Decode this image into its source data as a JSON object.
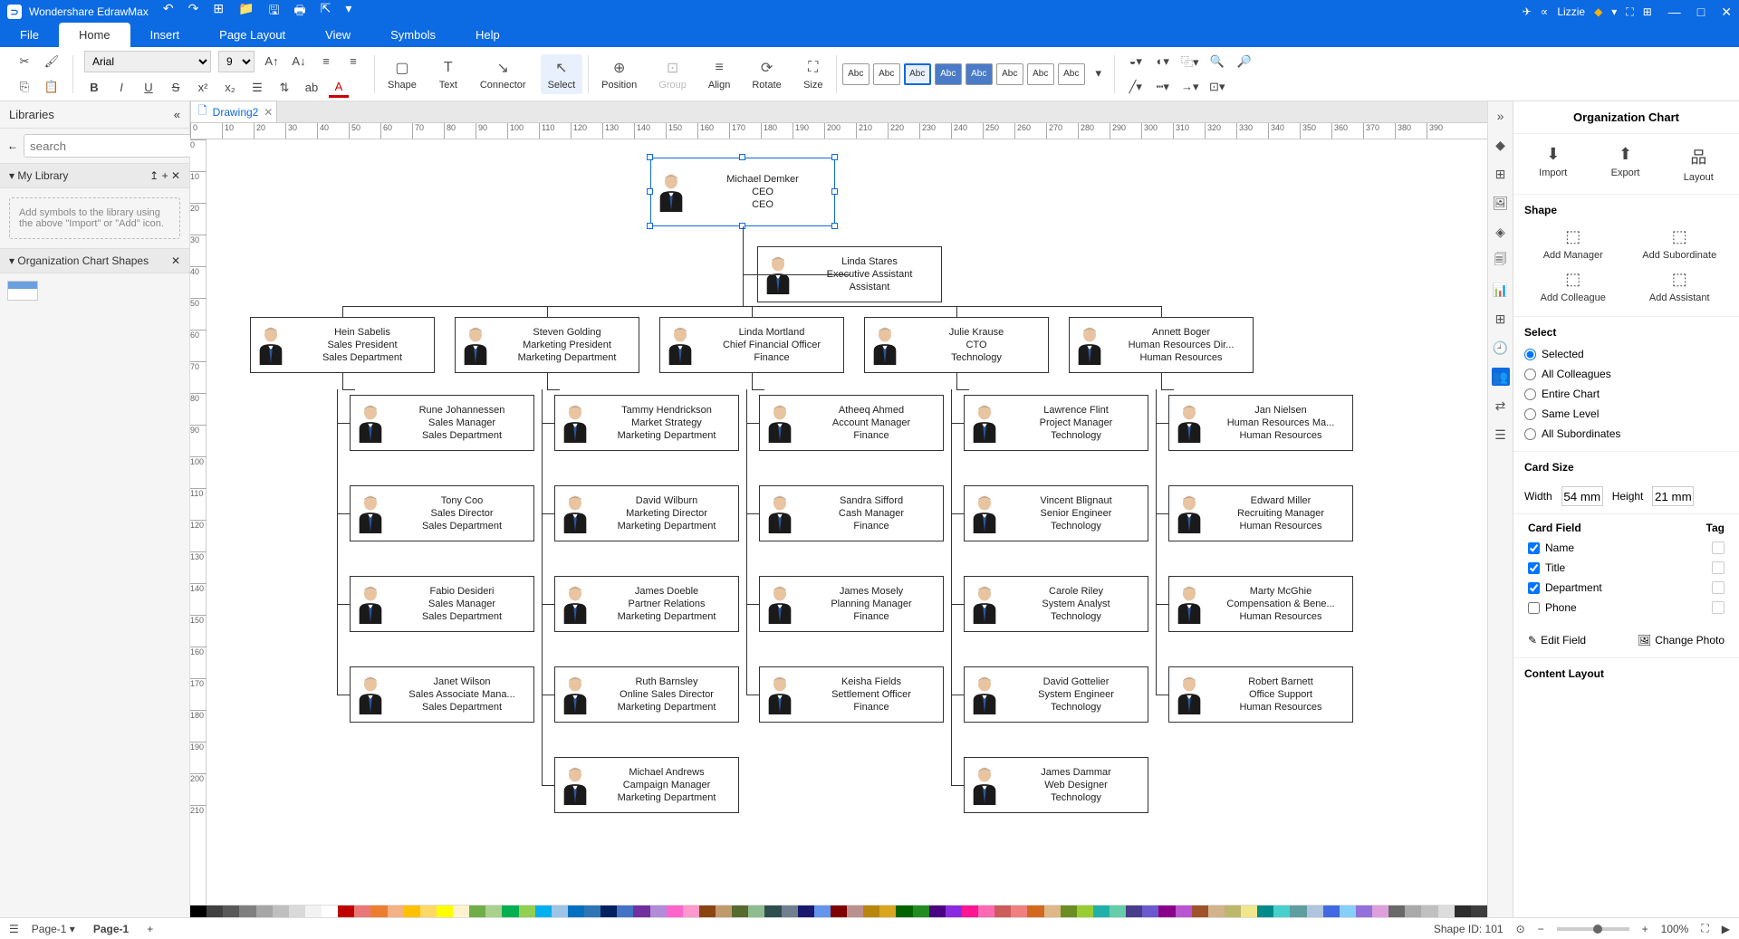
{
  "app": {
    "title": "Wondershare EdrawMax",
    "user": "Lizzie"
  },
  "menu": {
    "file": "File",
    "home": "Home",
    "insert": "Insert",
    "pagelayout": "Page Layout",
    "view": "View",
    "symbols": "Symbols",
    "help": "Help"
  },
  "ribbon": {
    "font": "Arial",
    "size": "9",
    "shape": "Shape",
    "text": "Text",
    "connector": "Connector",
    "select": "Select",
    "position": "Position",
    "group": "Group",
    "align": "Align",
    "rotate": "Rotate",
    "sizeLbl": "Size",
    "style": "Abc"
  },
  "left": {
    "libraries": "Libraries",
    "search_ph": "search",
    "mylib": "My Library",
    "addhint": "Add symbols to the library using the above \"Import\" or \"Add\" icon.",
    "orgshapes": "Organization Chart Shapes"
  },
  "doc": {
    "tab": "Drawing2"
  },
  "right": {
    "title": "Organization Chart",
    "import": "Import",
    "export": "Export",
    "layout": "Layout",
    "shape": "Shape",
    "addmgr": "Add Manager",
    "addsub": "Add Subordinate",
    "addcol": "Add Colleague",
    "addass": "Add Assistant",
    "select": "Select",
    "r_selected": "Selected",
    "r_allcol": "All Colleagues",
    "r_entire": "Entire Chart",
    "r_same": "Same Level",
    "r_allsub": "All Subordinates",
    "cardsize": "Card Size",
    "width": "Width",
    "wval": "54 mm",
    "height": "Height",
    "hval": "21 mm",
    "cardfield": "Card Field",
    "tag": "Tag",
    "f_name": "Name",
    "f_title": "Title",
    "f_dept": "Department",
    "f_phone": "Phone",
    "editfield": "Edit Field",
    "changephoto": "Change Photo",
    "contentlayout": "Content Layout"
  },
  "status": {
    "page": "Page-1",
    "pagetab": "Page-1",
    "shapeid": "Shape ID: 101",
    "zoom": "100%"
  },
  "chart": {
    "ceo": {
      "name": "Michael Demker",
      "title": "CEO",
      "dept": "CEO"
    },
    "assistant": {
      "name": "Linda Stares",
      "title": "Executive Assistant",
      "dept": "Assistant"
    },
    "managers": [
      {
        "name": "Hein Sabelis",
        "title": "Sales President",
        "dept": "Sales Department"
      },
      {
        "name": "Steven Golding",
        "title": "Marketing President",
        "dept": "Marketing Department"
      },
      {
        "name": "Linda Mortland",
        "title": "Chief Financial Officer",
        "dept": "Finance"
      },
      {
        "name": "Julie Krause",
        "title": "CTO",
        "dept": "Technology"
      },
      {
        "name": "Annett Boger",
        "title": "Human Resources Dir...",
        "dept": "Human Resources"
      }
    ],
    "subs": [
      [
        {
          "name": "Rune Johannessen",
          "title": "Sales Manager",
          "dept": "Sales Department"
        },
        {
          "name": "Tony Coo",
          "title": "Sales Director",
          "dept": "Sales Department"
        },
        {
          "name": "Fabio Desideri",
          "title": "Sales Manager",
          "dept": "Sales Department"
        },
        {
          "name": "Janet Wilson",
          "title": "Sales Associate Mana...",
          "dept": "Sales Department"
        }
      ],
      [
        {
          "name": "Tammy Hendrickson",
          "title": "Market Strategy",
          "dept": "Marketing Department"
        },
        {
          "name": "David Wilburn",
          "title": "Marketing Director",
          "dept": "Marketing Department"
        },
        {
          "name": "James Doeble",
          "title": "Partner Relations",
          "dept": "Marketing Department"
        },
        {
          "name": "Ruth Barnsley",
          "title": "Online Sales Director",
          "dept": "Marketing Department"
        },
        {
          "name": "Michael Andrews",
          "title": "Campaign Manager",
          "dept": "Marketing Department"
        }
      ],
      [
        {
          "name": "Atheeq Ahmed",
          "title": "Account Manager",
          "dept": "Finance"
        },
        {
          "name": "Sandra Sifford",
          "title": "Cash Manager",
          "dept": "Finance"
        },
        {
          "name": "James Mosely",
          "title": "Planning Manager",
          "dept": "Finance"
        },
        {
          "name": "Keisha Fields",
          "title": "Settlement Officer",
          "dept": "Finance"
        }
      ],
      [
        {
          "name": "Lawrence Flint",
          "title": "Project Manager",
          "dept": "Technology"
        },
        {
          "name": "Vincent Blignaut",
          "title": "Senior Engineer",
          "dept": "Technology"
        },
        {
          "name": "Carole Riley",
          "title": "System Analyst",
          "dept": "Technology"
        },
        {
          "name": "David Gottelier",
          "title": "System Engineer",
          "dept": "Technology"
        },
        {
          "name": "James Dammar",
          "title": "Web Designer",
          "dept": "Technology"
        }
      ],
      [
        {
          "name": "Jan Nielsen",
          "title": "Human Resources Ma...",
          "dept": "Human Resources"
        },
        {
          "name": "Edward Miller",
          "title": "Recruiting Manager",
          "dept": "Human Resources"
        },
        {
          "name": "Marty McGhie",
          "title": "Compensation & Bene...",
          "dept": "Human Resources"
        },
        {
          "name": "Robert Barnett",
          "title": "Office Support",
          "dept": "Human Resources"
        }
      ]
    ]
  },
  "ruler_h": [
    0,
    10,
    20,
    30,
    40,
    50,
    60,
    70,
    80,
    90,
    100,
    110,
    120,
    130,
    140,
    150,
    160,
    170,
    180,
    190,
    200,
    210,
    220,
    230,
    240,
    250,
    260,
    270,
    280,
    290,
    300,
    310,
    320,
    330,
    340,
    350,
    360,
    370,
    380,
    390
  ],
  "ruler_v": [
    0,
    10,
    20,
    30,
    40,
    50,
    60,
    70,
    80,
    90,
    100,
    110,
    120,
    130,
    140,
    150,
    160,
    170,
    180,
    190,
    200,
    210
  ],
  "colors": [
    "#000",
    "#404040",
    "#595959",
    "#7f7f7f",
    "#a6a6a6",
    "#bfbfbf",
    "#d9d9d9",
    "#f2f2f2",
    "#fff",
    "#c00000",
    "#e97777",
    "#ed7d31",
    "#f4b183",
    "#ffc000",
    "#ffd966",
    "#ffff00",
    "#fff2cc",
    "#70ad47",
    "#a9d18e",
    "#00b050",
    "#92d050",
    "#00b0f0",
    "#9dc3e6",
    "#0070c0",
    "#2e75b6",
    "#002060",
    "#4472c4",
    "#7030a0",
    "#b38cd9",
    "#ff66cc",
    "#ff99cc",
    "#8b4513",
    "#c19a6b",
    "#556b2f",
    "#8fbc8f",
    "#2f4f4f",
    "#708090",
    "#191970",
    "#6495ed",
    "#800000",
    "#bc8f8f",
    "#b8860b",
    "#daa520",
    "#006400",
    "#228b22",
    "#4b0082",
    "#8a2be2",
    "#ff1493",
    "#ff69b4",
    "#cd5c5c",
    "#f08080",
    "#d2691e",
    "#deb887",
    "#6b8e23",
    "#9acd32",
    "#20b2aa",
    "#66cdaa",
    "#483d8b",
    "#6a5acd",
    "#8b008b",
    "#ba55d3",
    "#a0522d",
    "#d2b48c",
    "#bdb76b",
    "#f0e68c",
    "#008b8b",
    "#48d1cc",
    "#5f9ea0",
    "#b0c4de",
    "#4169e1",
    "#87cefa",
    "#9370db",
    "#dda0dd",
    "#696969",
    "#a9a9a9",
    "#c0c0c0",
    "#dcdcdc",
    "#2d2d2d",
    "#3d3d3d"
  ]
}
